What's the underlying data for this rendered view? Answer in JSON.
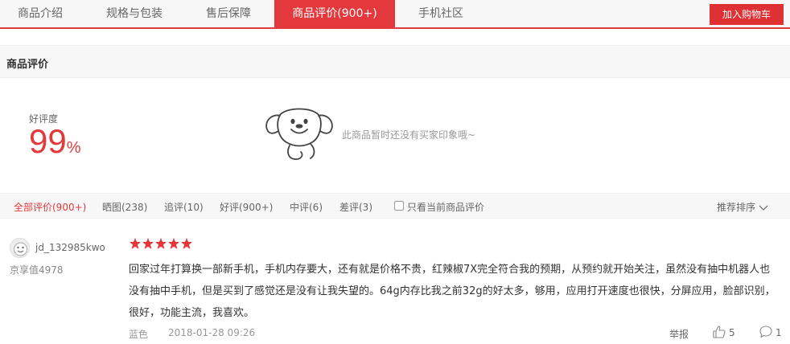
{
  "tabs": [
    {
      "label": "商品介绍"
    },
    {
      "label": "规格与包装"
    },
    {
      "label": "售后保障"
    },
    {
      "label": "商品评价(900+)"
    },
    {
      "label": "手机社区"
    }
  ],
  "cart_button": "加入购物车",
  "section_title": "商品评价",
  "rating": {
    "label": "好评度",
    "value": "99",
    "unit": "%"
  },
  "impressions_empty": "此商品暂时还没有买家印象哦~",
  "filters": [
    {
      "label": "全部评价(900+)"
    },
    {
      "label": "晒图(238)"
    },
    {
      "label": "追评(10)"
    },
    {
      "label": "好评(900+)"
    },
    {
      "label": "中评(6)"
    },
    {
      "label": "差评(3)"
    }
  ],
  "only_current_label": "只看当前商品评价",
  "sort_label": "推荐排序",
  "review": {
    "username": "jd_132985kwo",
    "user_level": "京享值4978",
    "stars": 5,
    "text": "回家过年打算换一部新手机，手机内存要大，还有就是价格不贵，红辣椒7X完全符合我的预期，从预约就开始关注，虽然没有抽中机器人也没有抽中手机，但是买到了感觉还是没有让我失望的。64g内存比我之前32g的好太多，够用，应用打开速度也很快，分屏应用，脸部识别，很好，功能主流，我喜欢。",
    "spec": "蓝色",
    "date": "2018-01-28 09:26",
    "report_label": "举报",
    "likes": "5",
    "comments": "1"
  },
  "colors": {
    "accent": "#e4393c",
    "star": "#e4393c"
  },
  "icons": [
    "mascot-icon",
    "checkbox-icon",
    "chevron-down-icon",
    "avatar-icon",
    "star-icon",
    "thumbs-up-icon",
    "comment-icon"
  ]
}
